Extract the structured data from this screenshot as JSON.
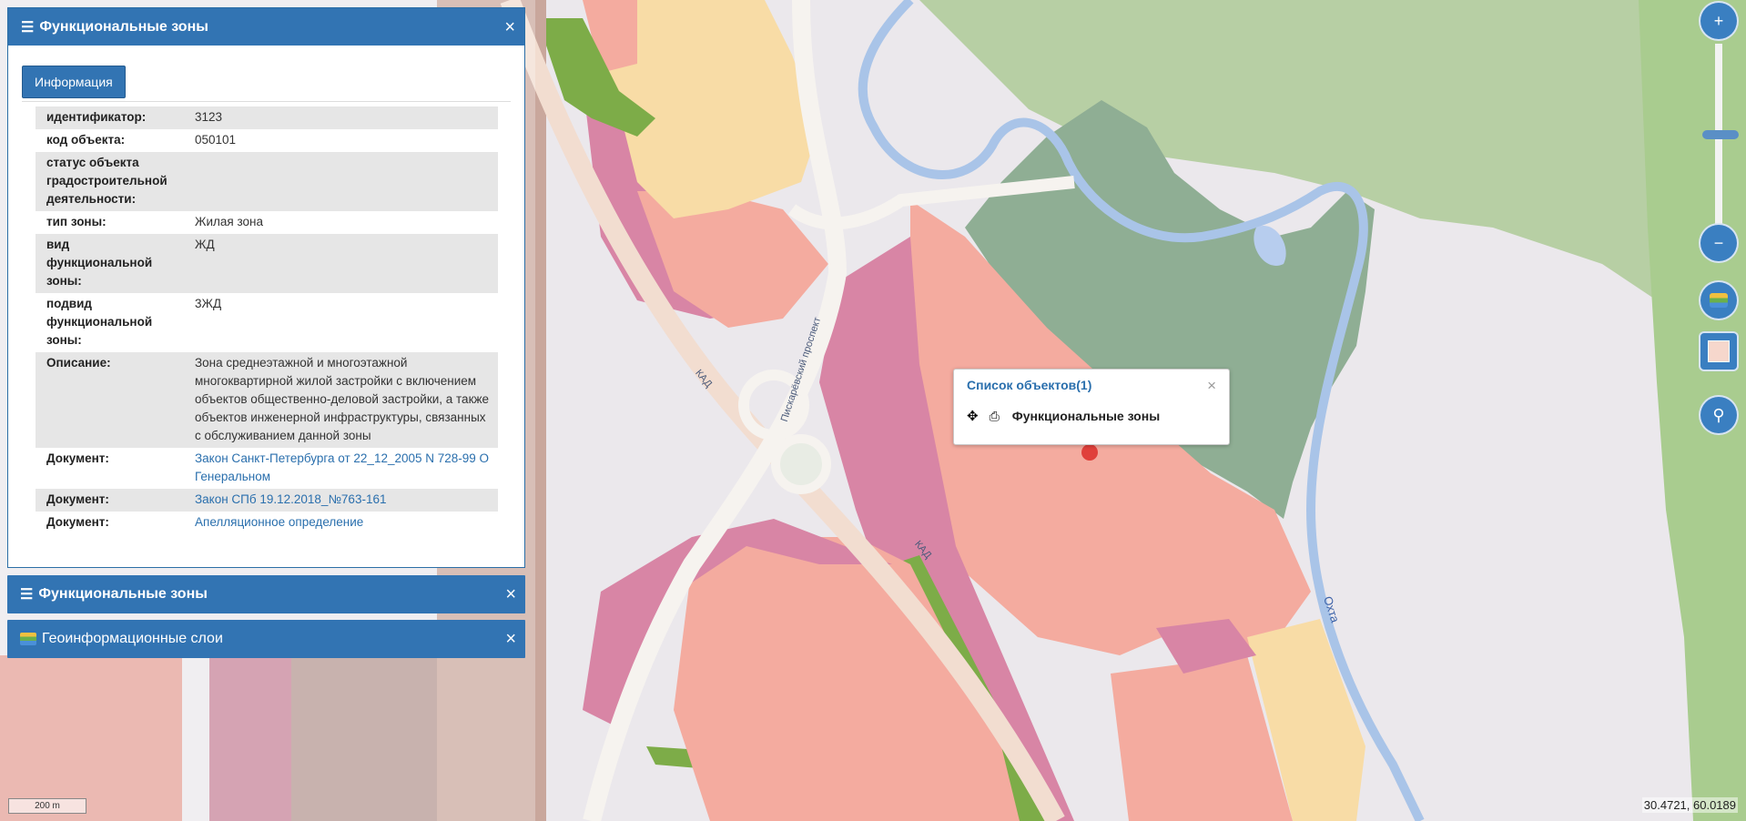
{
  "panel_main": {
    "title": "Функциональные зоны",
    "info_button": "Информация",
    "rows": [
      {
        "key": "идентификатор:",
        "value": "3123"
      },
      {
        "key": "код объекта:",
        "value": "050101"
      },
      {
        "key": "статус объекта градостроительной деятельности:",
        "value": ""
      },
      {
        "key": "тип зоны:",
        "value": "Жилая зона"
      },
      {
        "key": "вид функциональной зоны:",
        "value": "ЖД"
      },
      {
        "key": "подвид функциональной зоны:",
        "value": "3ЖД"
      },
      {
        "key": "Описание:",
        "value": "Зона среднеэтажной и многоэтажной многоквартирной жилой застройки с включением объектов общественно-деловой застройки, а также объектов инженерной инфраструктуры, связанных с обслуживанием данной зоны"
      },
      {
        "key": "Документ:",
        "value": "Закон Санкт-Петербурга от 22_12_2005 N 728-99 О Генеральном",
        "link": true
      },
      {
        "key": "Документ:",
        "value": "Закон СПб 19.12.2018_№763-161",
        "link": true
      },
      {
        "key": "Документ:",
        "value": "Апелляционное определение",
        "link": true
      }
    ]
  },
  "panel_second": {
    "title": "Функциональные зоны"
  },
  "panel_layers": {
    "title": "Геоинформационные слои"
  },
  "popup": {
    "title": "Список объектов(1)",
    "item": "Функциональные зоны"
  },
  "controls": {
    "zoom_in": "+",
    "zoom_out": "−",
    "zoom_level": 0.62
  },
  "map_labels": {
    "kad1": "КАД",
    "kad2": "КАД",
    "piskarevsky": "Пискарёвский проспект",
    "river": "Охта"
  },
  "scale": "200 m",
  "coords": "30.4721, 60.0189",
  "colors": {
    "header": "#3274b3",
    "residential": "#f6a99c",
    "business": "#d886a6",
    "green": "#7dac48",
    "forest": "#7aa27e",
    "water": "#b7cdee"
  }
}
